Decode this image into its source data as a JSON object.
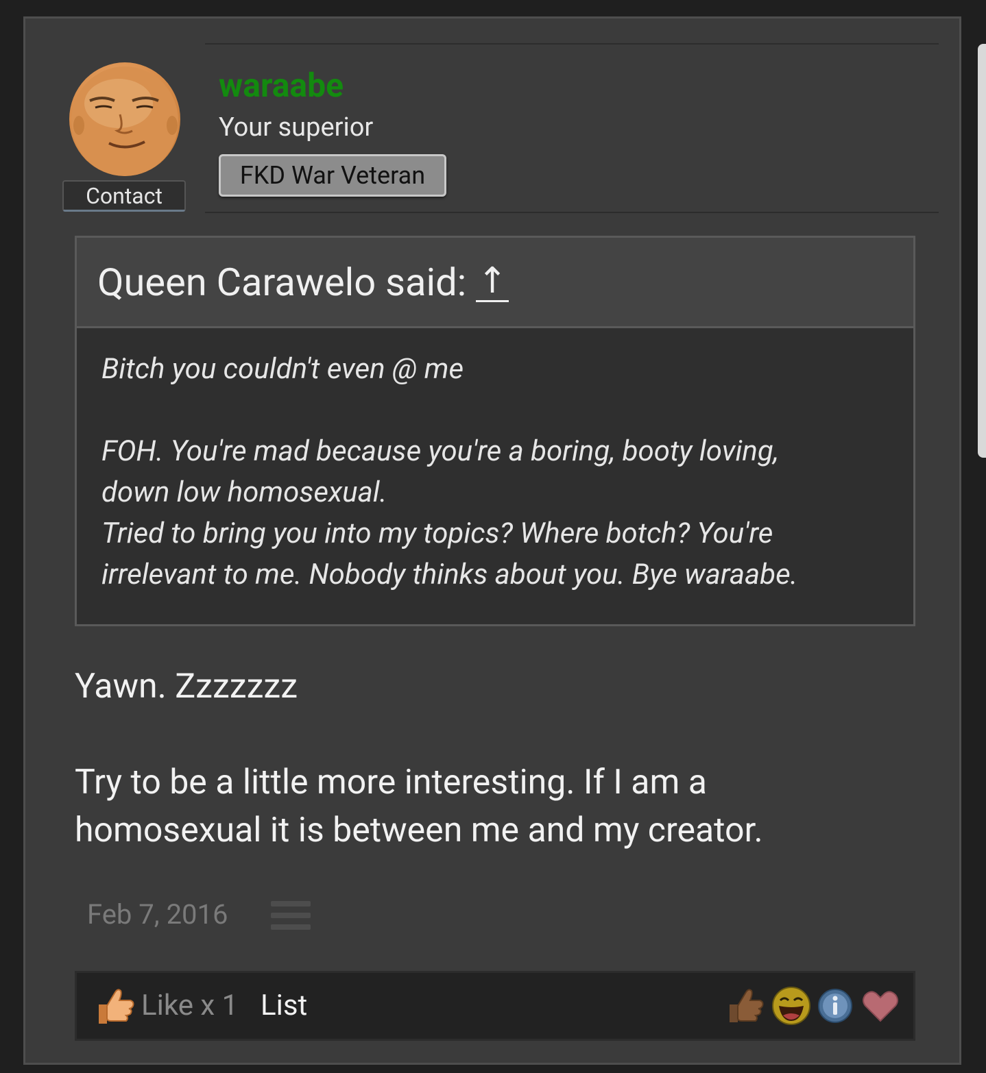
{
  "post": {
    "author": {
      "username": "waraabe",
      "user_title": "Your superior",
      "badge": "FKD War Veteran",
      "contact_label": "Contact",
      "username_color": "#138a0f"
    },
    "quote": {
      "header": "Queen Carawelo said:",
      "jump_arrow": "↑",
      "lines": [
        "Bitch you couldn't even @ me",
        "FOH. You're mad because you're a boring, booty loving,",
        "down low homosexual.",
        "Tried to bring you into my topics? Where botch? You're",
        "irrelevant to me. Nobody thinks about you. Bye waraabe."
      ]
    },
    "message": {
      "paragraph_1": "Yawn. Zzzzzzz",
      "paragraph_2_line_1": "Try to be a little more interesting. If I am a",
      "paragraph_2_line_2": "homosexual it is between me and my creator."
    },
    "date": "Feb 7, 2016",
    "likes": {
      "label": "Like x 1",
      "list_label": "List",
      "reactions": [
        "thumbs-up-icon",
        "laughing-face-icon",
        "info-icon",
        "heart-icon"
      ]
    }
  }
}
